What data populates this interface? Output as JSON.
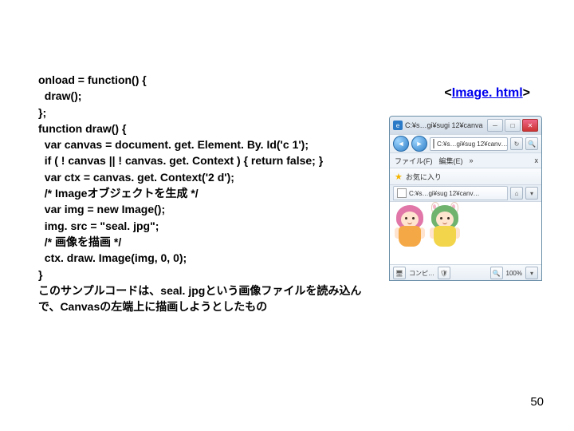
{
  "code": {
    "l1": "onload = function() {",
    "l2": "  draw();",
    "l3": "};",
    "l4": "function draw() {",
    "l5": "  var canvas = document. get. Element. By. Id('c 1');",
    "l6": "  if ( ! canvas || ! canvas. get. Context ) { return false; }",
    "l7": "  var ctx = canvas. get. Context('2 d');",
    "l8": "  /* Imageオブジェクトを生成 */",
    "l9": "  var img = new Image();",
    "l10": "  img. src = \"seal. jpg\";",
    "l11": "  /* 画像を描画 */",
    "l12": "  ctx. draw. Image(img, 0, 0);",
    "l13": "}",
    "l14": "このサンプルコードは、seal. jpgという画像ファイルを読み込んで、Canvasの左端上に描画しようとしたもの"
  },
  "link": {
    "lt": "<",
    "mid": "Image. html",
    "gt": ">"
  },
  "browser": {
    "title": "C:¥s…gi¥sugi 12¥canva",
    "addr": "C:¥s…gi¥sug 12¥canv…",
    "menu_file": "ファイル(F)",
    "menu_edit": "編集(E)",
    "menu_more": "»",
    "tab_close": "x",
    "fav": "お気に入り",
    "tab_text": "C:¥s…gi¥sug 12¥canv…",
    "status_label": "コンピ…",
    "zoom": "100%"
  },
  "page_number": "50"
}
